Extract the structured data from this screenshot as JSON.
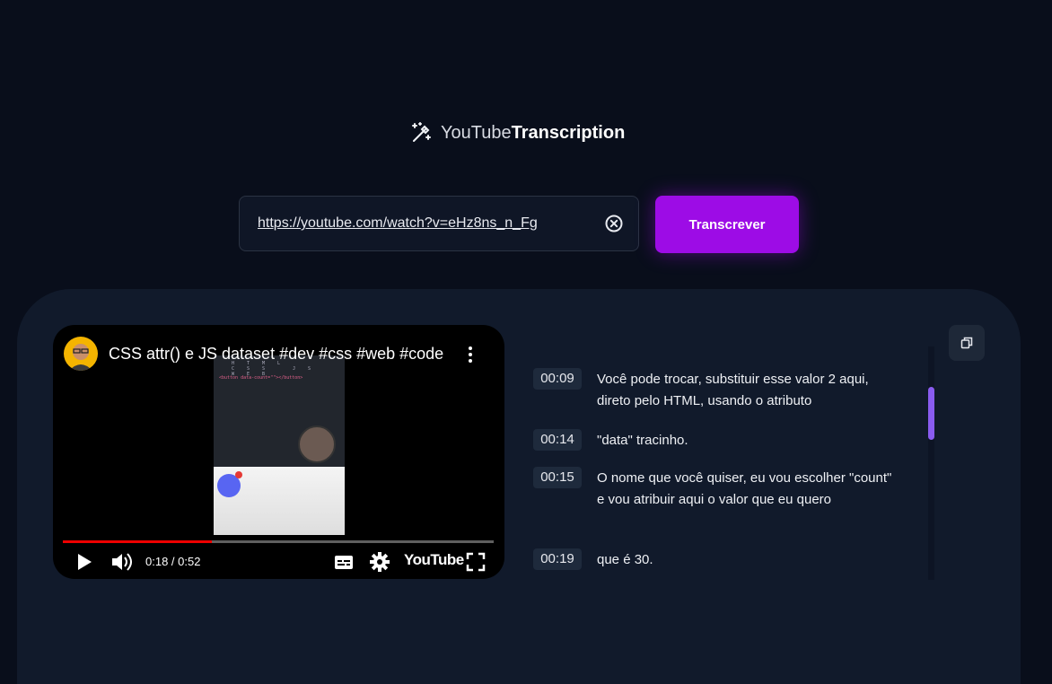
{
  "brand": {
    "light": "YouTube",
    "bold": "Transcription",
    "icon": "magic-wand-icon"
  },
  "search": {
    "value": "https://youtube.com/watch?v=eHz8ns_n_Fg",
    "clear_icon": "clear-circle-icon"
  },
  "actions": {
    "transcribe_label": "Transcrever",
    "copy_icon": "copy-icon"
  },
  "video": {
    "title": "CSS attr() e JS dataset #dev #css #web #code",
    "time": "0:18 / 0:52",
    "progress": 0.346,
    "logo_text": "YouTube",
    "thumb_tabs": "HTML CSS JS WEB",
    "thumb_code": "<button data-count=\"\"></button>"
  },
  "transcript": [
    {
      "time": "00:09",
      "text": "Você pode trocar, substituir esse valor 2 aqui, direto pelo HTML, usando o atributo"
    },
    {
      "time": "00:14",
      "text": "\"data\" tracinho."
    },
    {
      "time": "00:15",
      "text": "O nome que você quiser, eu vou escolher \"count\" e vou atribuir aqui o valor que eu quero"
    },
    {
      "time": "00:19",
      "text": "que é 30."
    }
  ],
  "colors": {
    "accent": "#9d0ce6",
    "background": "#090e1b",
    "panel": "#111a2b",
    "scroll_thumb": "#8a5cf0",
    "progress": "#ee0000"
  }
}
